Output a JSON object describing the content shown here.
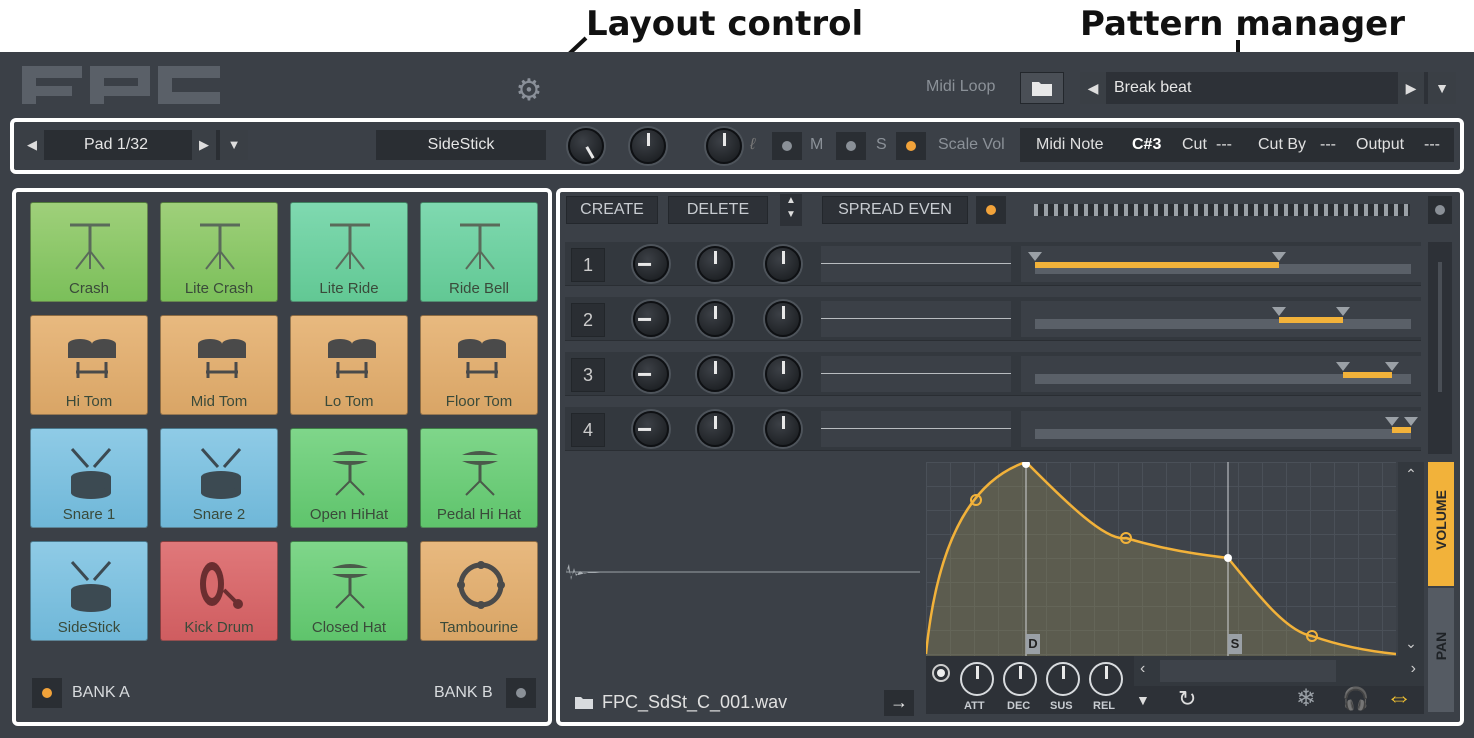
{
  "annotations": {
    "layout_control": "Layout control",
    "pattern_manager": "Pattern manager"
  },
  "header": {
    "midi_loop_label": "Midi Loop",
    "pattern_name": "Break beat"
  },
  "pad_bar": {
    "pad_label": "Pad 1/32",
    "sample_name": "SideStick",
    "mute": "M",
    "solo": "S",
    "scale_vol": "Scale Vol",
    "midi_note_label": "Midi Note",
    "midi_note_value": "C#3",
    "cut_label": "Cut",
    "cut_value": "---",
    "cut_by_label": "Cut By",
    "cut_by_value": "---",
    "output_label": "Output",
    "output_value": "---"
  },
  "pads": [
    {
      "label": "Crash",
      "color": "#8cc768",
      "icon": "cymbal-icon"
    },
    {
      "label": "Lite Crash",
      "color": "#8cc768",
      "icon": "cymbal-icon"
    },
    {
      "label": "Lite Ride",
      "color": "#6fd0a2",
      "icon": "cymbal-icon"
    },
    {
      "label": "Ride Bell",
      "color": "#6fd0a2",
      "icon": "cymbal-icon"
    },
    {
      "label": "Hi Tom",
      "color": "#e0ae72",
      "icon": "toms-icon"
    },
    {
      "label": "Mid Tom",
      "color": "#e0ae72",
      "icon": "toms-icon"
    },
    {
      "label": "Lo Tom",
      "color": "#e0ae72",
      "icon": "toms-icon"
    },
    {
      "label": "Floor Tom",
      "color": "#e0ae72",
      "icon": "toms-icon"
    },
    {
      "label": "Snare 1",
      "color": "#7fc1df",
      "icon": "snare-icon"
    },
    {
      "label": "Snare 2",
      "color": "#7fc1df",
      "icon": "snare-icon"
    },
    {
      "label": "Open HiHat",
      "color": "#6fcd7b",
      "icon": "hihat-icon"
    },
    {
      "label": "Pedal Hi Hat",
      "color": "#6fcd7b",
      "icon": "hihat-icon"
    },
    {
      "label": "SideStick",
      "color": "#7fc1df",
      "icon": "snare-icon"
    },
    {
      "label": "Kick Drum",
      "color": "#d76a6c",
      "icon": "kick-icon"
    },
    {
      "label": "Closed Hat",
      "color": "#6fcd7b",
      "icon": "hihat-icon"
    },
    {
      "label": "Tambourine",
      "color": "#e0ae72",
      "icon": "tambourine-icon"
    }
  ],
  "banks": {
    "a": "BANK A",
    "b": "BANK B"
  },
  "layers_toolbar": {
    "create": "CREATE",
    "delete": "DELETE",
    "spread_even": "SPREAD EVEN"
  },
  "layers": [
    {
      "num": "1",
      "range": [
        0.0,
        0.65
      ]
    },
    {
      "num": "2",
      "range": [
        0.65,
        0.82
      ]
    },
    {
      "num": "3",
      "range": [
        0.82,
        0.95
      ]
    },
    {
      "num": "4",
      "range": [
        0.95,
        1.0
      ]
    }
  ],
  "envelope": {
    "markers": {
      "decay": "D",
      "sustain": "S"
    },
    "knobs": [
      "ATT",
      "DEC",
      "SUS",
      "REL"
    ],
    "tabs": {
      "volume": "VOLUME",
      "pan": "PAN"
    }
  },
  "sample_file": "FPC_SdSt_C_001.wav",
  "colors": {
    "accent": "#f2b23a",
    "panel": "#3b4047",
    "dark": "#2a2e33"
  }
}
